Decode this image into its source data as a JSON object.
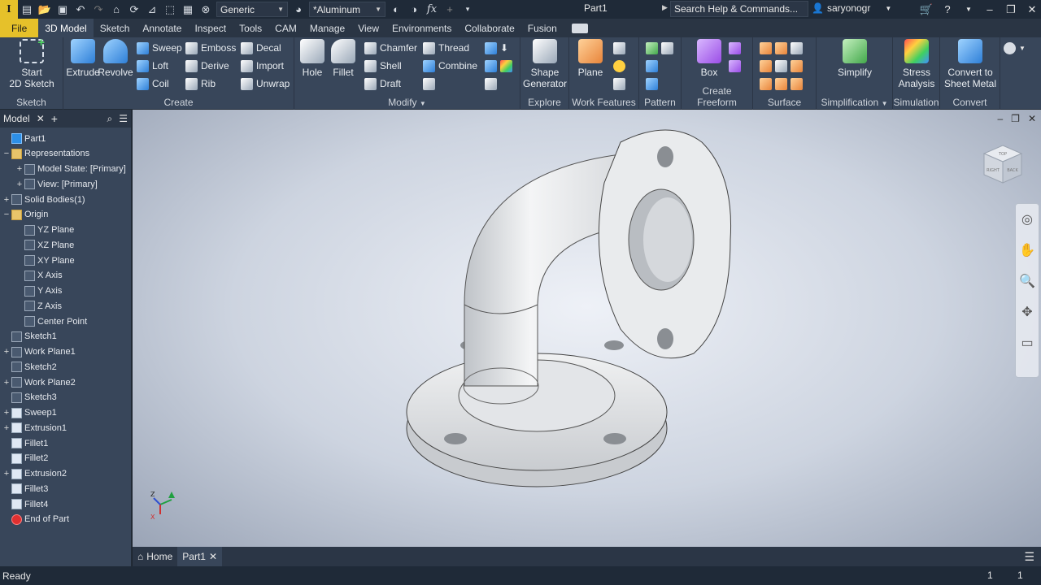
{
  "titlebar": {
    "appearance_select": "Generic",
    "material_select": "*Aluminum",
    "document_title": "Part1",
    "search_placeholder": "Search Help & Commands...",
    "username": "saryonogr"
  },
  "tabs": [
    "File",
    "3D Model",
    "Sketch",
    "Annotate",
    "Inspect",
    "Tools",
    "CAM",
    "Manage",
    "View",
    "Environments",
    "Collaborate",
    "Fusion"
  ],
  "ribbon": {
    "sketch": {
      "label": "Sketch",
      "start_sketch": "Start\n2D Sketch"
    },
    "create": {
      "label": "Create",
      "extrude": "Extrude",
      "revolve": "Revolve",
      "sweep": "Sweep",
      "loft": "Loft",
      "coil": "Coil",
      "emboss": "Emboss",
      "derive": "Derive",
      "rib": "Rib",
      "decal": "Decal",
      "import": "Import",
      "unwrap": "Unwrap"
    },
    "modify": {
      "label": "Modify",
      "hole": "Hole",
      "fillet": "Fillet",
      "chamfer": "Chamfer",
      "shell": "Shell",
      "draft": "Draft",
      "thread": "Thread",
      "combine": "Combine"
    },
    "explore": {
      "label": "Explore",
      "shape_generator": "Shape\nGenerator"
    },
    "work_features": {
      "label": "Work Features",
      "plane": "Plane"
    },
    "pattern": {
      "label": "Pattern"
    },
    "create_freeform": {
      "label": "Create Freeform",
      "box": "Box"
    },
    "surface": {
      "label": "Surface"
    },
    "simplification": {
      "label": "Simplification",
      "simplify": "Simplify"
    },
    "simulation": {
      "label": "Simulation",
      "stress_analysis": "Stress\nAnalysis"
    },
    "convert": {
      "label": "Convert",
      "sheet_metal": "Convert to\nSheet Metal"
    }
  },
  "browser": {
    "tab_label": "Model",
    "nodes": [
      {
        "label": "Part1",
        "level": 0,
        "exp": "",
        "icon": "blue"
      },
      {
        "label": "Representations",
        "level": 0,
        "exp": "−",
        "icon": "folder"
      },
      {
        "label": "Model State: [Primary]",
        "level": 1,
        "exp": "+",
        "icon": "plain"
      },
      {
        "label": "View: [Primary]",
        "level": 1,
        "exp": "+",
        "icon": "plain"
      },
      {
        "label": "Solid Bodies(1)",
        "level": 0,
        "exp": "+",
        "icon": "plain"
      },
      {
        "label": "Origin",
        "level": 0,
        "exp": "−",
        "icon": "folder"
      },
      {
        "label": "YZ Plane",
        "level": 1,
        "exp": "",
        "icon": "plain"
      },
      {
        "label": "XZ Plane",
        "level": 1,
        "exp": "",
        "icon": "plain"
      },
      {
        "label": "XY Plane",
        "level": 1,
        "exp": "",
        "icon": "plain"
      },
      {
        "label": "X Axis",
        "level": 1,
        "exp": "",
        "icon": "plain"
      },
      {
        "label": "Y Axis",
        "level": 1,
        "exp": "",
        "icon": "plain"
      },
      {
        "label": "Z Axis",
        "level": 1,
        "exp": "",
        "icon": "plain"
      },
      {
        "label": "Center Point",
        "level": 1,
        "exp": "",
        "icon": "plain"
      },
      {
        "label": "Sketch1",
        "level": 0,
        "exp": "",
        "icon": "plain"
      },
      {
        "label": "Work Plane1",
        "level": 0,
        "exp": "+",
        "icon": "plain"
      },
      {
        "label": "Sketch2",
        "level": 0,
        "exp": "",
        "icon": "plain"
      },
      {
        "label": "Work Plane2",
        "level": 0,
        "exp": "+",
        "icon": "plain"
      },
      {
        "label": "Sketch3",
        "level": 0,
        "exp": "",
        "icon": "plain"
      },
      {
        "label": "Sweep1",
        "level": 0,
        "exp": "+",
        "icon": "doc"
      },
      {
        "label": "Extrusion1",
        "level": 0,
        "exp": "+",
        "icon": "doc"
      },
      {
        "label": "Fillet1",
        "level": 0,
        "exp": "",
        "icon": "doc"
      },
      {
        "label": "Fillet2",
        "level": 0,
        "exp": "",
        "icon": "doc"
      },
      {
        "label": "Extrusion2",
        "level": 0,
        "exp": "+",
        "icon": "doc"
      },
      {
        "label": "Fillet3",
        "level": 0,
        "exp": "",
        "icon": "doc"
      },
      {
        "label": "Fillet4",
        "level": 0,
        "exp": "",
        "icon": "doc"
      },
      {
        "label": "End of Part",
        "level": 0,
        "exp": "",
        "icon": "red"
      }
    ]
  },
  "viewcube": {
    "face_top": "TOP",
    "face_right": "RIGHT",
    "face_back": "BACK"
  },
  "triad": {
    "x": "X",
    "z": "Z"
  },
  "doctabs": {
    "home": "Home",
    "part": "Part1"
  },
  "status": {
    "text": "Ready",
    "count1": "1",
    "count2": "1"
  }
}
